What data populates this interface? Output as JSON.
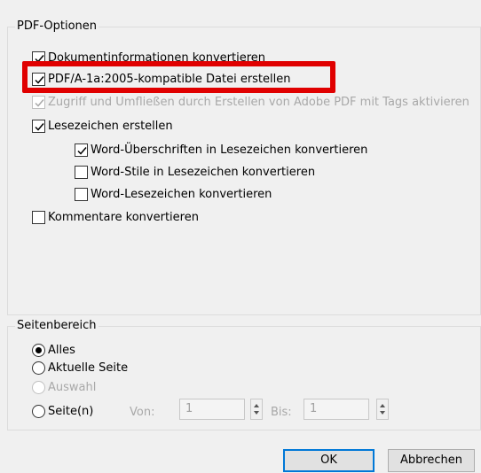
{
  "pdf_options": {
    "title": "PDF-Optionen",
    "items": [
      {
        "label": "Dokumentinformationen konvertieren",
        "checked": true,
        "enabled": true
      },
      {
        "label": "PDF/A-1a:2005-kompatible Datei erstellen",
        "checked": true,
        "enabled": true
      },
      {
        "label": "Zugriff und Umfließen durch Erstellen von Adobe PDF mit Tags aktivieren",
        "checked": true,
        "enabled": false
      },
      {
        "label": "Lesezeichen erstellen",
        "checked": true,
        "enabled": true
      },
      {
        "label": "Word-Überschriften in Lesezeichen konvertieren",
        "checked": true,
        "enabled": true
      },
      {
        "label": "Word-Stile in Lesezeichen konvertieren",
        "checked": false,
        "enabled": true
      },
      {
        "label": "Word-Lesezeichen konvertieren",
        "checked": false,
        "enabled": true
      },
      {
        "label": "Kommentare konvertieren",
        "checked": false,
        "enabled": true
      }
    ]
  },
  "page_range": {
    "title": "Seitenbereich",
    "options": [
      {
        "label": "Alles",
        "selected": true,
        "enabled": true
      },
      {
        "label": "Aktuelle Seite",
        "selected": false,
        "enabled": true
      },
      {
        "label": "Auswahl",
        "selected": false,
        "enabled": false
      },
      {
        "label": "Seite(n)",
        "selected": false,
        "enabled": true
      }
    ],
    "from_label": "Von:",
    "from_value": "1",
    "to_label": "Bis:",
    "to_value": "1"
  },
  "buttons": {
    "ok": "OK",
    "cancel": "Abbrechen"
  },
  "colors": {
    "highlight": "#e00000",
    "default_button_border": "#0078d7"
  }
}
